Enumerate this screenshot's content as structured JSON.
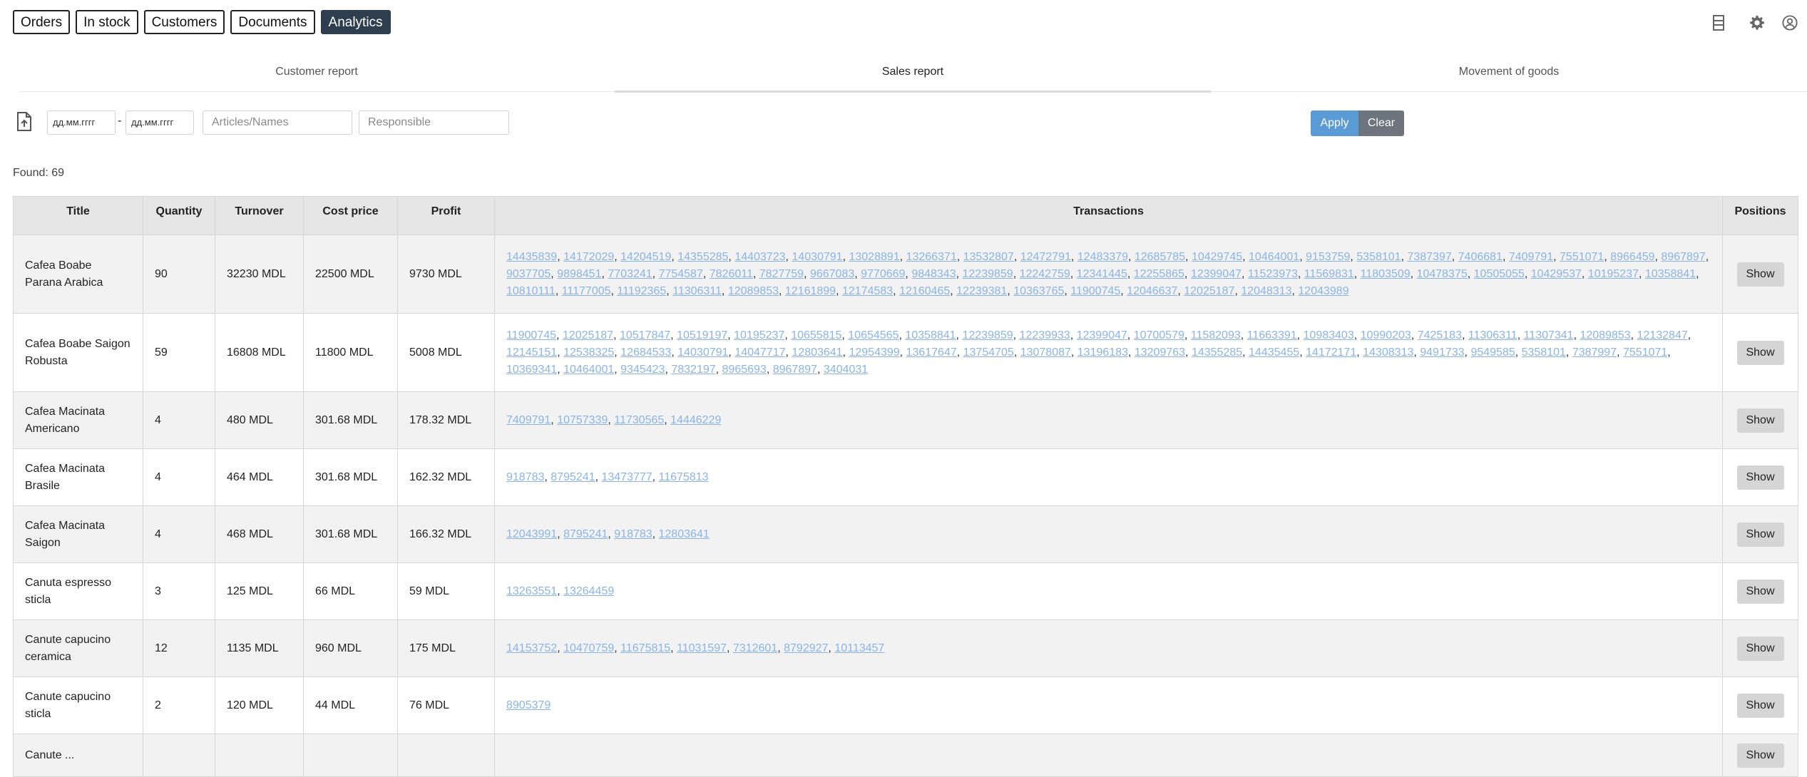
{
  "nav": {
    "items": [
      {
        "label": "Orders",
        "active": false
      },
      {
        "label": "In stock",
        "active": false
      },
      {
        "label": "Customers",
        "active": false
      },
      {
        "label": "Documents",
        "active": false
      },
      {
        "label": "Analytics",
        "active": true
      }
    ],
    "icons": [
      "layout-icon",
      "gear-icon",
      "user-icon"
    ]
  },
  "tabs": [
    {
      "label": "Customer report",
      "active": false
    },
    {
      "label": "Sales report",
      "active": true
    },
    {
      "label": "Movement of goods",
      "active": false
    }
  ],
  "filters": {
    "date_from_placeholder": "дд.мм.гггг",
    "separator": "-",
    "date_to_placeholder": "дд.мм.гггг",
    "articles_placeholder": "Articles/Names",
    "responsible_placeholder": "Responsible",
    "apply_label": "Apply",
    "clear_label": "Clear"
  },
  "found": "Found: 69",
  "table": {
    "headers": [
      "Title",
      "Quantity",
      "Turnover",
      "Cost price",
      "Profit",
      "Transactions",
      "Positions"
    ],
    "rows": [
      {
        "title": "Cafea Boabe Parana Arabica",
        "quantity": "90",
        "turnover": "32230 MDL",
        "cost": "22500 MDL",
        "profit": "9730 MDL",
        "transactions": [
          "14435839",
          "14172029",
          "14204519",
          "14355285",
          "14403723",
          "14030791",
          "13028891",
          "13266371",
          "13532807",
          "12472791",
          "12483379",
          "12685785",
          "10429745",
          "10464001",
          "9153759",
          "5358101",
          "7387397",
          "7406681",
          "7409791",
          "7551071",
          "8966459",
          "8967897",
          "9037705",
          "9898451",
          "7703241",
          "7754587",
          "7826011",
          "7827759",
          "9667083",
          "9770669",
          "9848343",
          "12239859",
          "12242759",
          "12341445",
          "12255865",
          "12399047",
          "11523973",
          "11569831",
          "11803509",
          "10478375",
          "10505055",
          "10429537",
          "10195237",
          "10358841",
          "10810111",
          "11177005",
          "11192365",
          "11306311",
          "12089853",
          "12161899",
          "12174583",
          "12160465",
          "12239381",
          "10363765",
          "11900745",
          "12046637",
          "12025187",
          "12048313",
          "12043989"
        ],
        "show_label": "Show"
      },
      {
        "title": "Cafea Boabe Saigon Robusta",
        "quantity": "59",
        "turnover": "16808 MDL",
        "cost": "11800 MDL",
        "profit": "5008 MDL",
        "transactions": [
          "11900745",
          "12025187",
          "10517847",
          "10519197",
          "10195237",
          "10655815",
          "10654565",
          "10358841",
          "12239859",
          "12239933",
          "12399047",
          "10700579",
          "11582093",
          "11663391",
          "10983403",
          "10990203",
          "7425183",
          "11306311",
          "11307341",
          "12089853",
          "12132847",
          "12145151",
          "12538325",
          "12684533",
          "14030791",
          "14047717",
          "12803641",
          "12954399",
          "13617647",
          "13754705",
          "13078087",
          "13196183",
          "13209763",
          "14355285",
          "14435455",
          "14172171",
          "14308313",
          "9491733",
          "9549585",
          "5358101",
          "7387997",
          "7551071",
          "10369341",
          "10464001",
          "9345423",
          "7832197",
          "8965693",
          "8967897",
          "3404031"
        ],
        "show_label": "Show"
      },
      {
        "title": "Cafea Macinata Americano",
        "quantity": "4",
        "turnover": "480 MDL",
        "cost": "301.68 MDL",
        "profit": "178.32 MDL",
        "transactions": [
          "7409791",
          "10757339",
          "11730565",
          "14446229"
        ],
        "show_label": "Show"
      },
      {
        "title": "Cafea Macinata Brasile",
        "quantity": "4",
        "turnover": "464 MDL",
        "cost": "301.68 MDL",
        "profit": "162.32 MDL",
        "transactions": [
          "918783",
          "8795241",
          "13473777",
          "11675813"
        ],
        "show_label": "Show"
      },
      {
        "title": "Cafea Macinata Saigon",
        "quantity": "4",
        "turnover": "468 MDL",
        "cost": "301.68 MDL",
        "profit": "166.32 MDL",
        "transactions": [
          "12043991",
          "8795241",
          "918783",
          "12803641"
        ],
        "show_label": "Show"
      },
      {
        "title": "Canuta espresso sticla",
        "quantity": "3",
        "turnover": "125 MDL",
        "cost": "66 MDL",
        "profit": "59 MDL",
        "transactions": [
          "13263551",
          "13264459"
        ],
        "show_label": "Show"
      },
      {
        "title": "Canute capucino ceramica",
        "quantity": "12",
        "turnover": "1135 MDL",
        "cost": "960 MDL",
        "profit": "175 MDL",
        "transactions": [
          "14153752",
          "10470759",
          "11675815",
          "11031597",
          "7312601",
          "8792927",
          "10113457"
        ],
        "show_label": "Show"
      },
      {
        "title": "Canute capucino sticla",
        "quantity": "2",
        "turnover": "120 MDL",
        "cost": "44 MDL",
        "profit": "76 MDL",
        "transactions": [
          "8905379"
        ],
        "show_label": "Show"
      },
      {
        "title": "Canute ...",
        "quantity": "",
        "turnover": "",
        "cost": "",
        "profit": "",
        "transactions": [],
        "show_label": "Show"
      }
    ]
  }
}
